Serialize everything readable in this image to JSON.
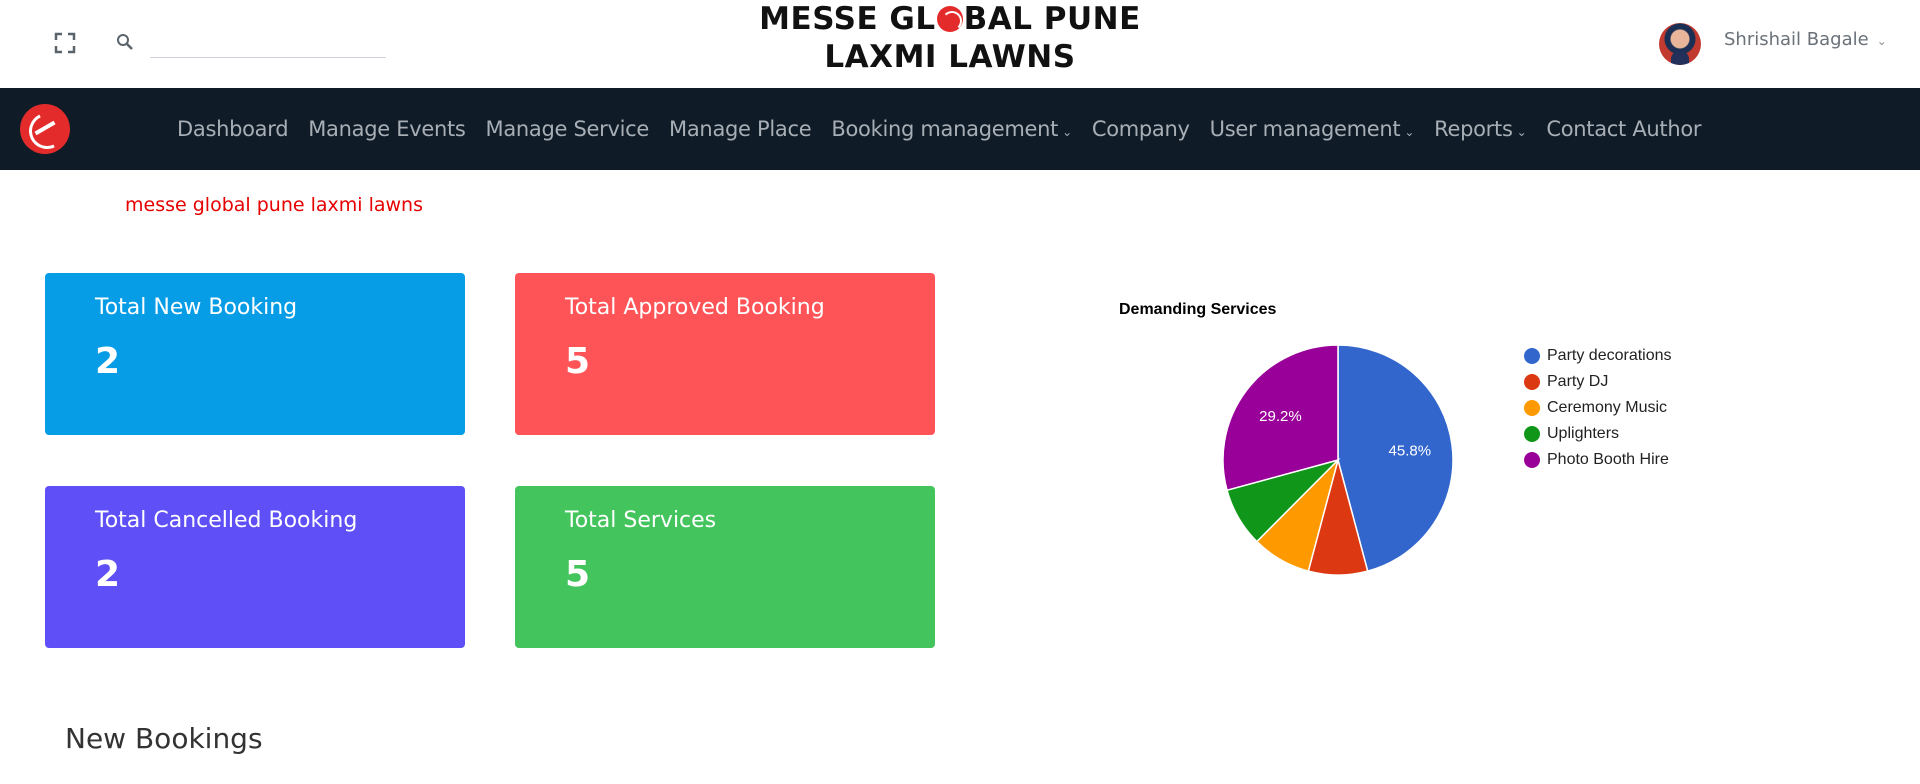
{
  "header": {
    "search": {
      "value": "",
      "placeholder": ""
    },
    "brand_line1_a": "MESSE GL",
    "brand_line1_b": "BAL PUNE",
    "brand_line2": "LAXMI LAWNS",
    "user_name": "Shrishail Bagale",
    "icons": {
      "fullscreen": "fullscreen-icon",
      "search": "search-icon",
      "user_menu": "chevron-down-icon"
    }
  },
  "nav": {
    "items": [
      {
        "label": "Dashboard",
        "has_dropdown": false
      },
      {
        "label": "Manage Events",
        "has_dropdown": false
      },
      {
        "label": "Manage Service",
        "has_dropdown": false
      },
      {
        "label": "Manage Place",
        "has_dropdown": false
      },
      {
        "label": "Booking management",
        "has_dropdown": true
      },
      {
        "label": "Company",
        "has_dropdown": false
      },
      {
        "label": "User management",
        "has_dropdown": true
      },
      {
        "label": "Reports",
        "has_dropdown": true
      },
      {
        "label": "Contact Author",
        "has_dropdown": false
      }
    ],
    "caret": "⌄"
  },
  "page": {
    "subtitle": "messe global pune laxmi lawns",
    "section_heading": "New Bookings"
  },
  "cards": [
    {
      "label": "Total New Booking",
      "value": "2",
      "color": "#079de6"
    },
    {
      "label": "Total Approved Booking",
      "value": "5",
      "color": "#ff5457"
    },
    {
      "label": "Total Cancelled Booking",
      "value": "2",
      "color": "#5f4ff7"
    },
    {
      "label": "Total Services",
      "value": "5",
      "color": "#44c45d"
    }
  ],
  "chart_data": {
    "type": "pie",
    "title": "Demanding Services",
    "legend_position": "right",
    "labels": [
      "Party decorations",
      "Party DJ",
      "Ceremony Music",
      "Uplighters",
      "Photo Booth Hire"
    ],
    "values": [
      45.8,
      8.3,
      8.3,
      8.3,
      29.2
    ],
    "slice_labels": [
      "45.8%",
      "",
      "",
      "",
      "29.2%"
    ],
    "colors": [
      "#3366cc",
      "#dc3912",
      "#ff9900",
      "#109618",
      "#990099"
    ]
  }
}
